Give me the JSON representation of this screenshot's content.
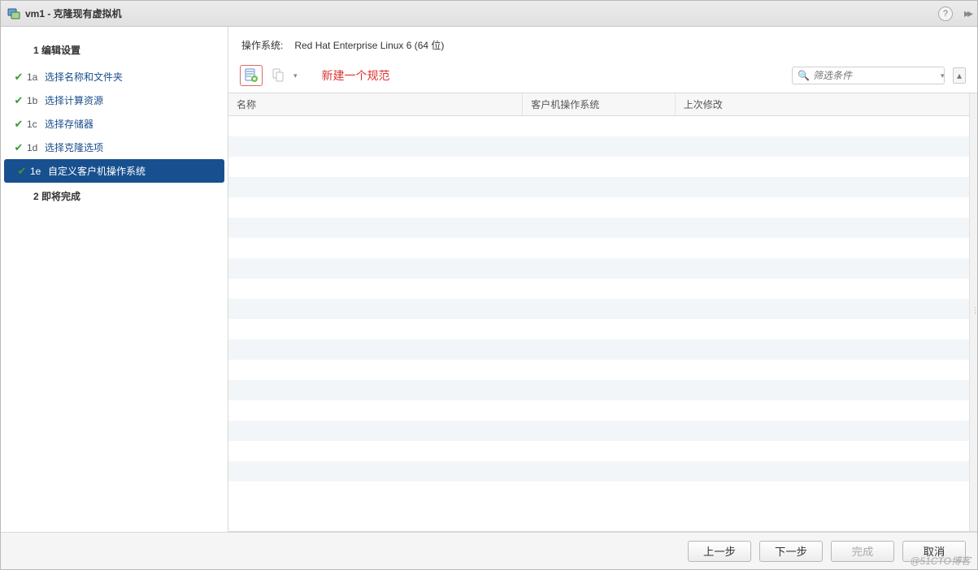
{
  "title": "vm1 - 克隆现有虚拟机",
  "sidebar": {
    "section1": {
      "num": "1",
      "label": "编辑设置"
    },
    "items": [
      {
        "code": "1a",
        "label": "选择名称和文件夹",
        "done": true
      },
      {
        "code": "1b",
        "label": "选择计算资源",
        "done": true
      },
      {
        "code": "1c",
        "label": "选择存储器",
        "done": true
      },
      {
        "code": "1d",
        "label": "选择克隆选项",
        "done": true
      },
      {
        "code": "1e",
        "label": "自定义客户机操作系统",
        "done": true,
        "active": true
      }
    ],
    "section2": {
      "num": "2",
      "label": "即将完成"
    }
  },
  "main": {
    "os_label": "操作系统:",
    "os_value": "Red Hat Enterprise Linux 6 (64 位)",
    "annotation": "新建一个规范",
    "filter_placeholder": "筛选条件"
  },
  "columns": {
    "name": "名称",
    "guest_os": "客户机操作系统",
    "last_modified": "上次修改"
  },
  "buttons": {
    "back": "上一步",
    "next": "下一步",
    "finish": "完成",
    "cancel": "取消"
  },
  "watermark": "@51CTO博客"
}
